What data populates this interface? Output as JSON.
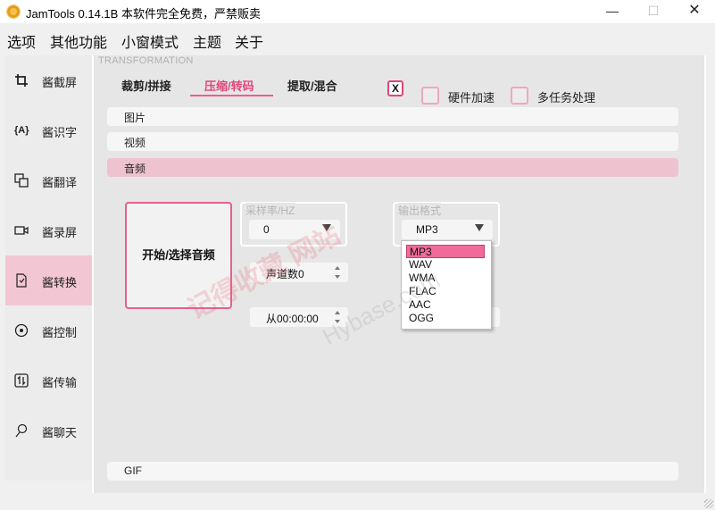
{
  "window": {
    "title": "JamTools 0.14.1B 本软件完全免费，严禁贩卖"
  },
  "menu": [
    "选项",
    "其他功能",
    "小窗模式",
    "主题",
    "关于"
  ],
  "sidebar": {
    "items": [
      {
        "label": "酱截屏",
        "icon": "crop-icon"
      },
      {
        "label": "酱识字",
        "icon": "ocr-icon"
      },
      {
        "label": "酱翻译",
        "icon": "translate-icon"
      },
      {
        "label": "酱录屏",
        "icon": "video-camera-icon"
      },
      {
        "label": "酱转换",
        "icon": "convert-icon",
        "active": true
      },
      {
        "label": "酱控制",
        "icon": "control-icon"
      },
      {
        "label": "酱传输",
        "icon": "transfer-icon"
      },
      {
        "label": "酱聊天",
        "icon": "chat-icon"
      }
    ]
  },
  "main": {
    "caption": "TRANSFORMATION",
    "tabs": [
      "裁剪/拼接",
      "压缩/转码",
      "提取/混合"
    ],
    "active_tab": 1,
    "close_label": "X",
    "options": [
      "硬件加速",
      "多任务处理"
    ],
    "bars": [
      "图片",
      "视频",
      "音频",
      "GIF"
    ],
    "active_bar": 2,
    "start_button": "开始/选择音频",
    "sample_rate": {
      "title": "采样率/HZ",
      "value": "0"
    },
    "channels": {
      "value": "声道数0"
    },
    "start_time": {
      "value": "从00:00:00"
    },
    "output_format": {
      "title": "输出格式",
      "value": "MP3",
      "options": [
        "MP3",
        "WAV",
        "WMA",
        "FLAC",
        "AAC",
        "OGG"
      ],
      "selected": "MP3"
    }
  },
  "watermark": {
    "cn": "记得收藏 网站",
    "en": "Hybase.com"
  },
  "colors": {
    "accent": "#e8608c",
    "active_bg": "#f3c6d3",
    "panel_bg": "#e6e6e6"
  }
}
